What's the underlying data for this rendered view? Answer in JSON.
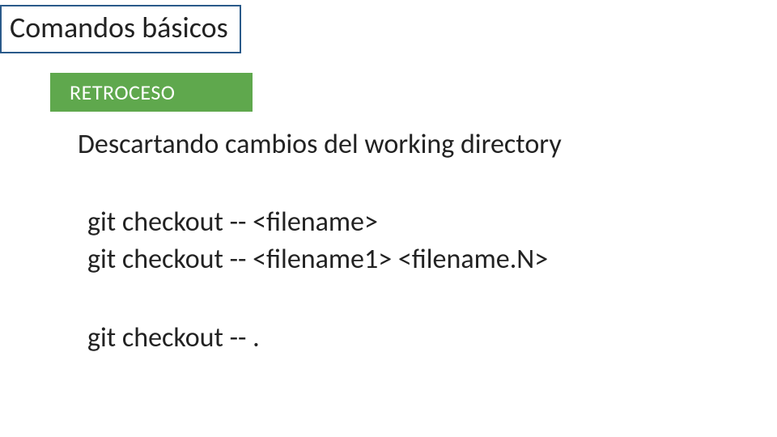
{
  "slide": {
    "title": "Comandos básicos",
    "badge": "RETROCESO",
    "subheading": "Descartando cambios del working directory",
    "commands_block1": {
      "line1": "git checkout -- <filename>",
      "line2": "git checkout -- <filename1> <filename.N>"
    },
    "commands_block2": {
      "line1": "git checkout -- ."
    }
  }
}
